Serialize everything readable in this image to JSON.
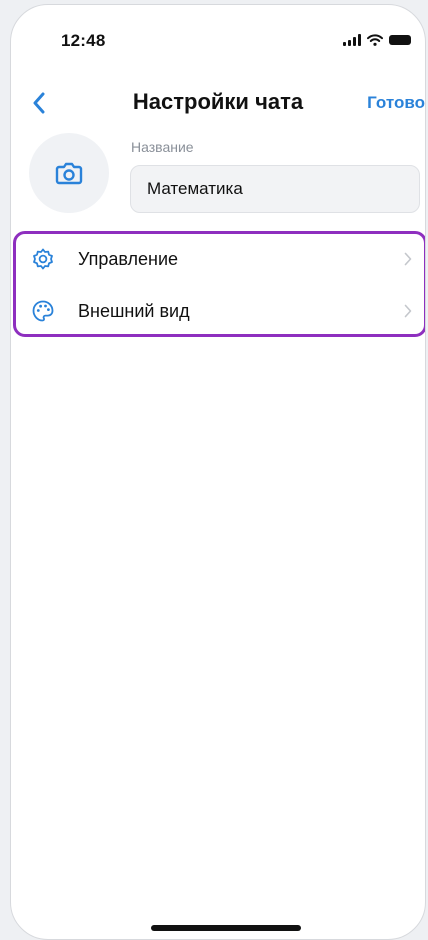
{
  "status_bar": {
    "time": "12:48"
  },
  "nav": {
    "title": "Настройки чата",
    "done_label": "Готово"
  },
  "profile": {
    "name_label": "Название",
    "name_value": "Математика"
  },
  "menu": {
    "items": [
      {
        "label": "Управление",
        "icon": "gear-icon"
      },
      {
        "label": "Внешний вид",
        "icon": "palette-icon"
      }
    ]
  },
  "colors": {
    "accent": "#2a82d9",
    "highlight_border": "#8e2fbf",
    "avatar_bg": "#f0f2f5"
  }
}
